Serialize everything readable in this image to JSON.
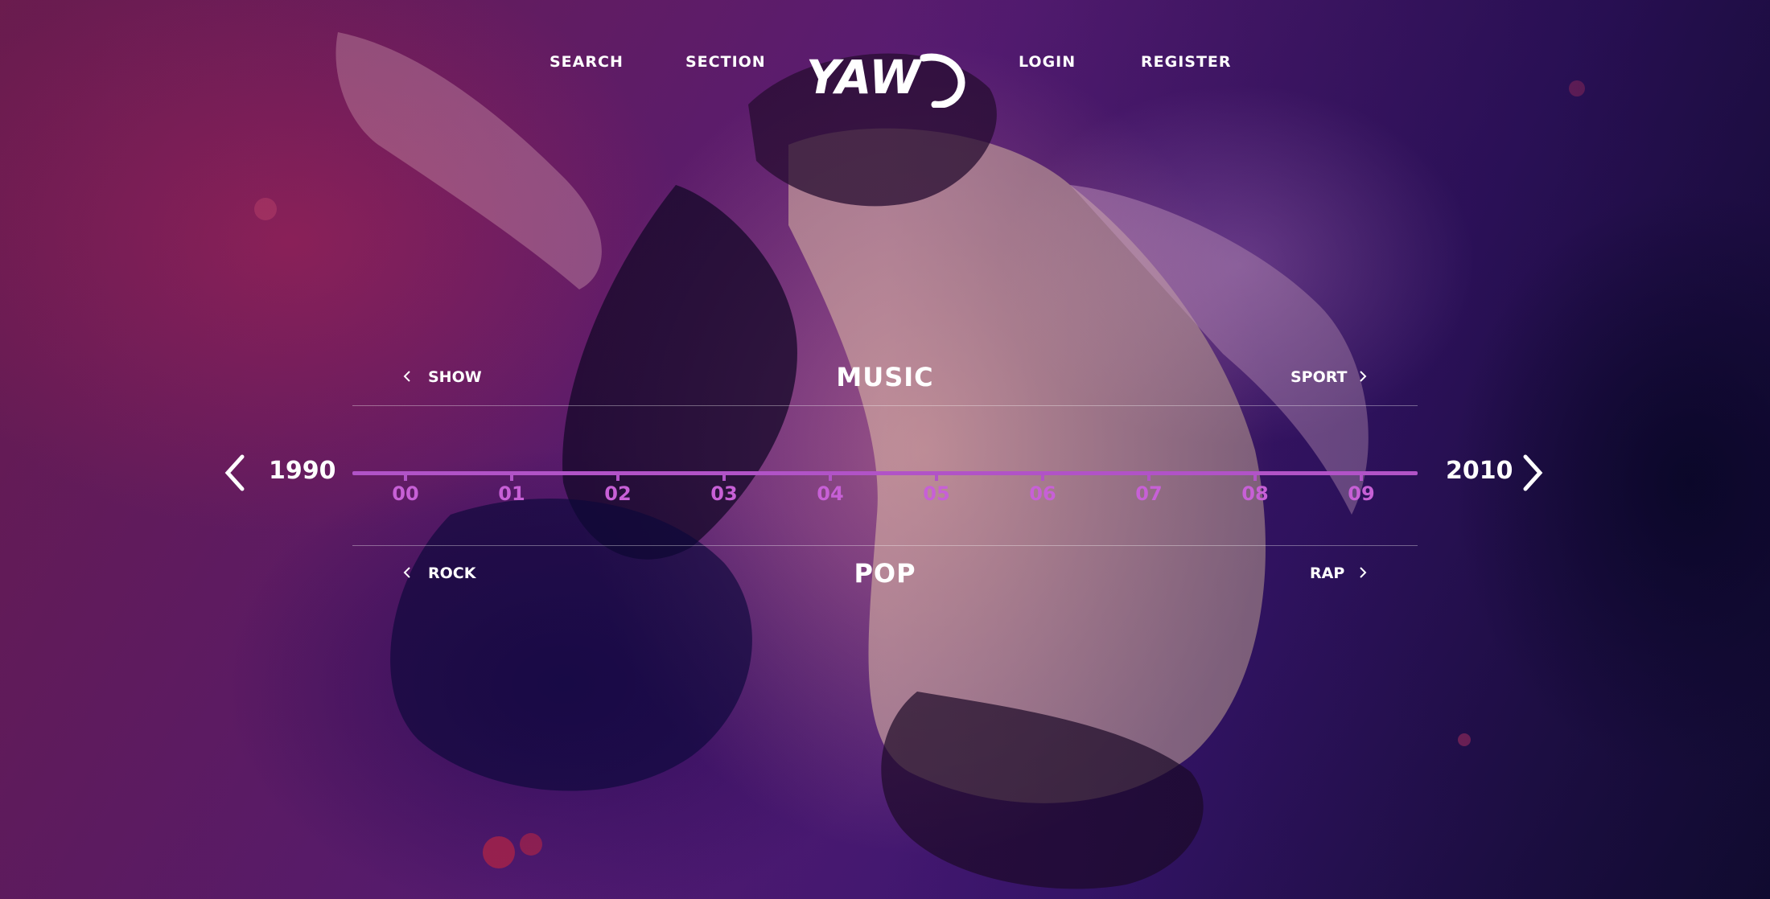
{
  "nav": {
    "search": "SEARCH",
    "section": "SECTION",
    "logo_text": "YAW",
    "login": "LOGIN",
    "register": "REGISTER"
  },
  "category_top": {
    "prev": "SHOW",
    "current": "MUSIC",
    "next": "SPORT"
  },
  "timeline": {
    "start_year": "1990",
    "end_year": "2010",
    "ticks": [
      "00",
      "01",
      "02",
      "03",
      "04",
      "05",
      "06",
      "07",
      "08",
      "09"
    ],
    "accent_color": "#b153c7"
  },
  "category_bottom": {
    "prev": "ROCK",
    "current": "POP",
    "next": "RAP"
  },
  "icons": [
    "chevron-left-icon",
    "chevron-right-icon",
    "arrow-left-icon",
    "arrow-right-icon",
    "logo-swoosh-icon"
  ]
}
